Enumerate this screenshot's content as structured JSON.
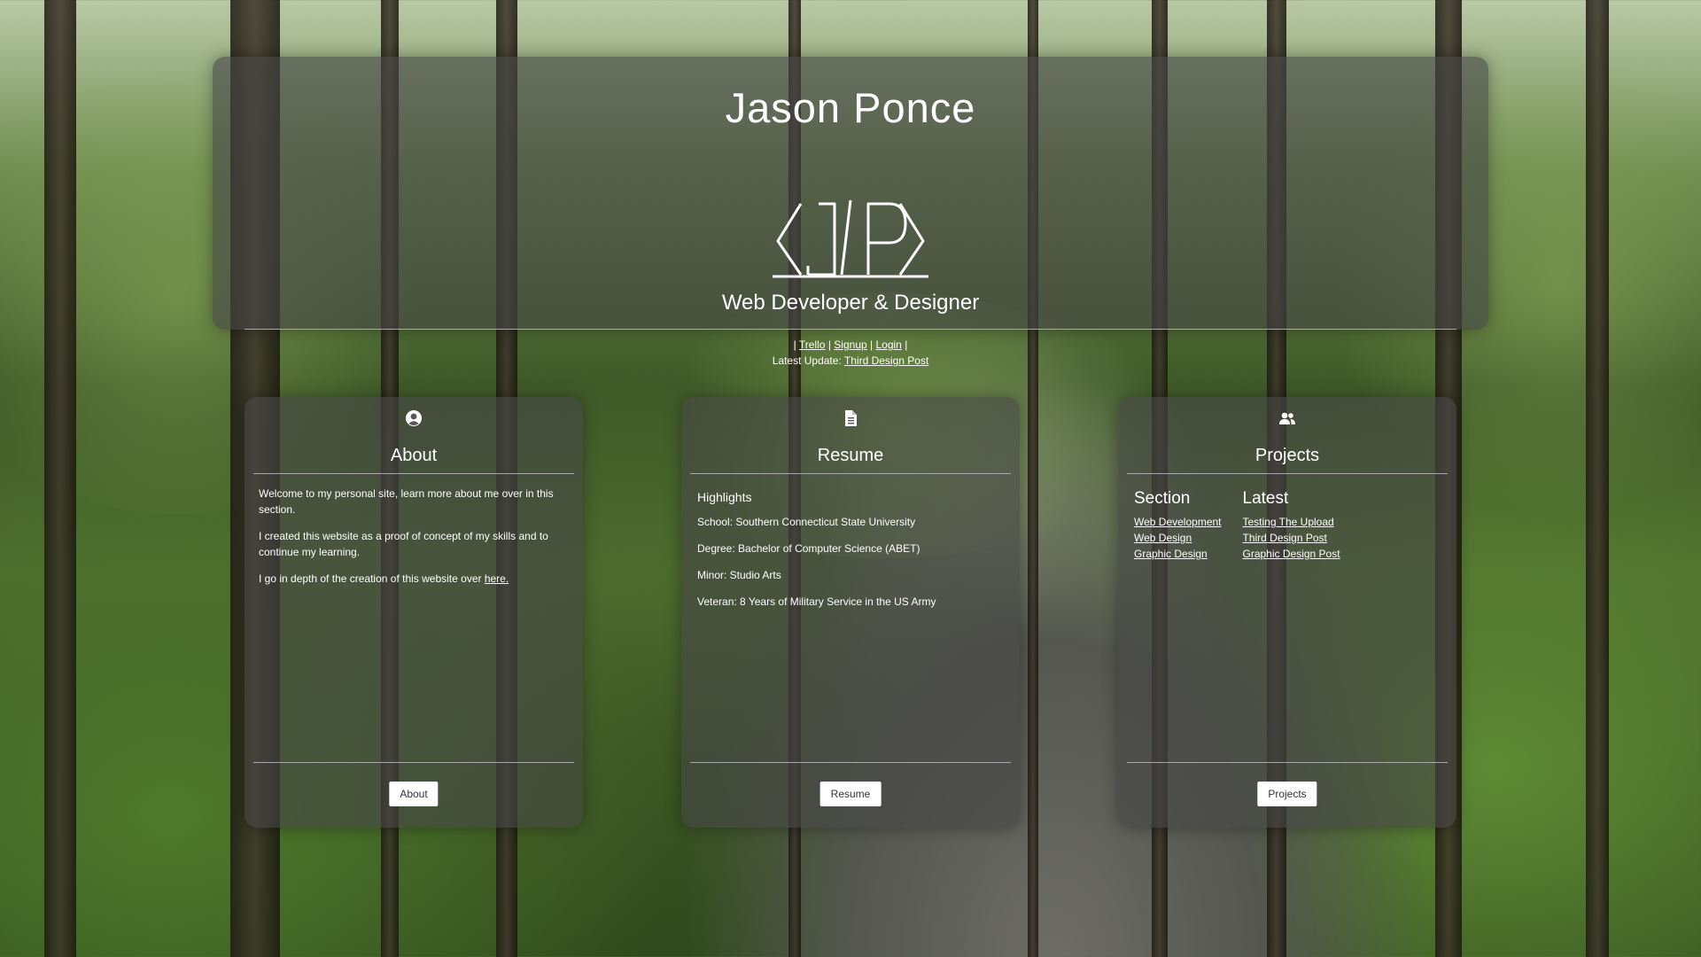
{
  "header": {
    "title": "Jason Ponce",
    "subtitle": "Web Developer & Designer",
    "nav": {
      "sep": "|",
      "trello": "Trello",
      "signup": "Signup",
      "login": "Login"
    },
    "update_prefix": "Latest Update:",
    "update_link": "Third Design Post"
  },
  "about": {
    "icon": "user-circle-icon",
    "title": "About",
    "p1": "Welcome to my personal site, learn more about me over in this section.",
    "p2": "I created this website as a proof of concept of my skills and to continue my learning.",
    "p3_prefix": "I go in depth of the creation of this website over",
    "p3_link": "here.",
    "button": "About"
  },
  "resume": {
    "icon": "document-icon",
    "title": "Resume",
    "highlights": "Highlights",
    "school": "School: Southern Connecticut State University",
    "degree": "Degree: Bachelor of Computer Science (ABET)",
    "minor": "Minor: Studio Arts",
    "veteran": "Veteran: 8 Years of Military Service in the US Army",
    "button": "Resume"
  },
  "projects": {
    "icon": "users-icon",
    "title": "Projects",
    "section_title": "Section",
    "latest_title": "Latest",
    "sections": [
      "Web Development",
      "Web Design",
      "Graphic Design"
    ],
    "latest": [
      "Testing The Upload",
      "Third Design Post",
      "Graphic Design Post"
    ],
    "button": "Projects"
  }
}
